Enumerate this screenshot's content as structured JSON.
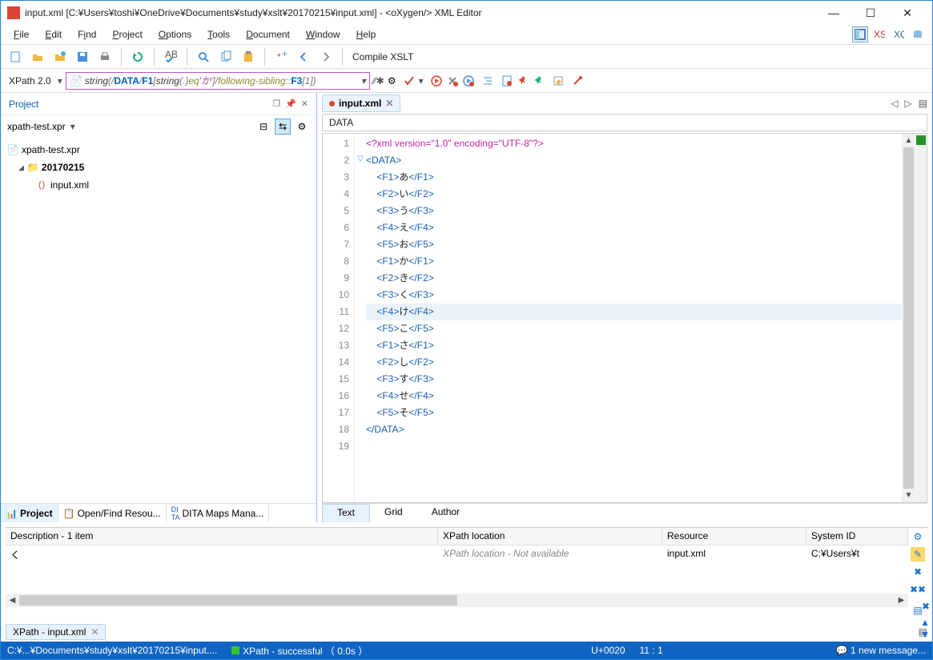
{
  "titlebar": {
    "title": "input.xml [C:¥Users¥toshi¥OneDrive¥Documents¥study¥xslt¥20170215¥input.xml] - <oXygen/> XML Editor"
  },
  "menu": {
    "file": "File",
    "edit": "Edit",
    "find": "Find",
    "project": "Project",
    "options": "Options",
    "tools": "Tools",
    "document": "Document",
    "window": "Window",
    "help": "Help"
  },
  "toolbar1": {
    "compile": "Compile XSLT"
  },
  "toolbar2": {
    "version": "XPath 2.0",
    "xpath": {
      "p1": "string",
      "p2": "(/",
      "p3": "DATA",
      "p4": "/",
      "p5": "F1",
      "p6": "[",
      "p7": "string",
      "p8": "(.)",
      "p9": " eq ",
      "p10": "'か'",
      "p11": "]/",
      "p12": "following-sibling::",
      "p13": "F3",
      "p14": "[1])"
    }
  },
  "project": {
    "header": "Project",
    "dropdown": "xpath-test.xpr",
    "root": "xpath-test.xpr",
    "folder": "20170215",
    "file": "input.xml",
    "tabs": {
      "project": "Project",
      "open_find": "Open/Find Resou...",
      "dita": "DITA Maps Mana..."
    }
  },
  "editor": {
    "tab_label": "input.xml",
    "breadcrumb": "DATA",
    "lines": [
      {
        "n": "1",
        "type": "pi",
        "text": "<?xml version=\"1.0\" encoding=\"UTF-8\"?>"
      },
      {
        "n": "2",
        "type": "tag",
        "text": "<DATA>",
        "fold": "▽"
      },
      {
        "n": "3",
        "type": "el",
        "tag": "F1",
        "txt": "あ"
      },
      {
        "n": "4",
        "type": "el",
        "tag": "F2",
        "txt": "い"
      },
      {
        "n": "5",
        "type": "el",
        "tag": "F3",
        "txt": "う"
      },
      {
        "n": "6",
        "type": "el",
        "tag": "F4",
        "txt": "え"
      },
      {
        "n": "7",
        "type": "el",
        "tag": "F5",
        "txt": "お"
      },
      {
        "n": "8",
        "type": "el",
        "tag": "F1",
        "txt": "か"
      },
      {
        "n": "9",
        "type": "el",
        "tag": "F2",
        "txt": "き"
      },
      {
        "n": "10",
        "type": "el",
        "tag": "F3",
        "txt": "く"
      },
      {
        "n": "11",
        "type": "el",
        "tag": "F4",
        "txt": "け",
        "hl": true
      },
      {
        "n": "12",
        "type": "el",
        "tag": "F5",
        "txt": "こ"
      },
      {
        "n": "13",
        "type": "el",
        "tag": "F1",
        "txt": "さ"
      },
      {
        "n": "14",
        "type": "el",
        "tag": "F2",
        "txt": "し"
      },
      {
        "n": "15",
        "type": "el",
        "tag": "F3",
        "txt": "す"
      },
      {
        "n": "16",
        "type": "el",
        "tag": "F4",
        "txt": "せ"
      },
      {
        "n": "17",
        "type": "el",
        "tag": "F5",
        "txt": "そ"
      },
      {
        "n": "18",
        "type": "tag",
        "text": "</DATA>"
      },
      {
        "n": "19",
        "type": "blank",
        "text": ""
      }
    ],
    "modes": {
      "text": "Text",
      "grid": "Grid",
      "author": "Author"
    }
  },
  "results": {
    "cols": {
      "desc": "Description - 1 item",
      "xpath": "XPath location",
      "resource": "Resource",
      "sysid": "System ID"
    },
    "row": {
      "desc": "く",
      "xpath": "XPath location - Not available",
      "resource": "input.xml",
      "sysid": "C:¥Users¥t"
    },
    "tab": "XPath - input.xml"
  },
  "status": {
    "path": "C:¥...¥Documents¥study¥xslt¥20170215¥input....",
    "xpath": "XPath - successful （ 0.0s ）",
    "char": "U+0020",
    "pos": "11 : 1",
    "msg": "1 new message..."
  }
}
